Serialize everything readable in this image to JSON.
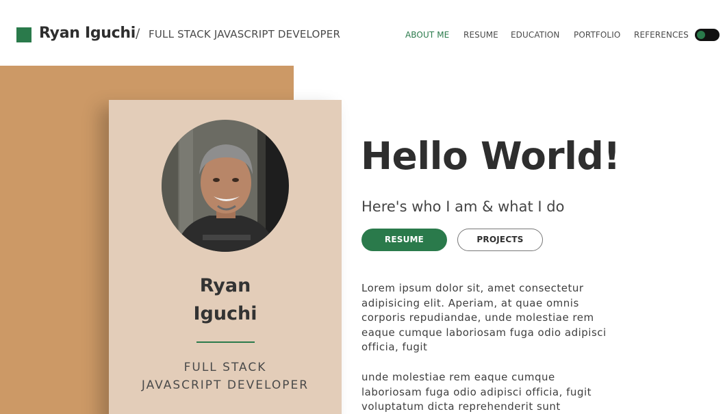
{
  "header": {
    "site_name": "Ryan Iguchi",
    "separator": "/",
    "subtitle": "FULL STACK JAVASCRIPT DEVELOPER",
    "brand_color": "#2a7a4b",
    "logo_icon": "green-square-logo-icon"
  },
  "nav": {
    "items": [
      {
        "label": "ABOUT ME",
        "active": true
      },
      {
        "label": "RESUME",
        "active": false
      },
      {
        "label": "EDUCATION",
        "active": false
      },
      {
        "label": "PORTFOLIO",
        "active": false
      },
      {
        "label": "REFERENCES",
        "active": false
      }
    ],
    "theme_toggle_icon": "dark-mode-toggle"
  },
  "card": {
    "name_line1": "Ryan",
    "name_line2": "Iguchi",
    "role_line1": "FULL STACK",
    "role_line2": "JAVASCRIPT DEVELOPER",
    "background_color": "#e3cdb9",
    "accent_block_color": "#cc9966"
  },
  "hero": {
    "heading": "Hello World!",
    "tagline": "Here's who I am & what I do",
    "resume_button": "RESUME",
    "projects_button": "PROJECTS",
    "paragraph1": "Lorem ipsum dolor sit, amet consectetur adipisicing elit. Aperiam, at quae omnis corporis repudiandae, unde molestiae rem eaque cumque laboriosam fuga odio adipisci officia, fugit",
    "paragraph2": "unde molestiae rem eaque cumque laboriosam fuga odio adipisci officia, fugit voluptatum dicta reprehenderit sunt"
  }
}
